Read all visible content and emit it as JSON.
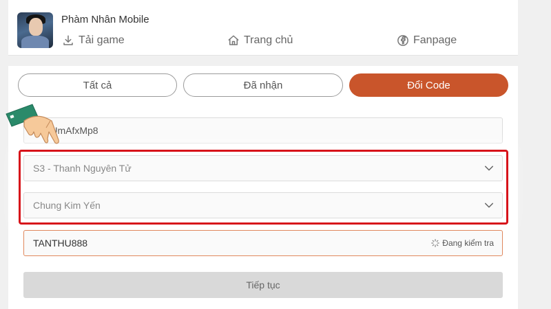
{
  "header": {
    "game_title": "Phàm Nhân Mobile",
    "nav": [
      {
        "label": "Tải game",
        "icon": "download-icon"
      },
      {
        "label": "Trang chủ",
        "icon": "home-icon"
      },
      {
        "label": "Fanpage",
        "icon": "facebook-icon"
      }
    ]
  },
  "tabs": [
    {
      "label": "Tất cả",
      "active": false
    },
    {
      "label": "Đã nhận",
      "active": false
    },
    {
      "label": "Đổi Code",
      "active": true
    }
  ],
  "form": {
    "account_value": "VUmAfxMp8",
    "server_value": "S3 - Thanh Nguyên Tử",
    "character_value": "Chung Kim Yến",
    "code_value": "TANTHU888",
    "code_status": "Đang kiểm tra",
    "continue_label": "Tiếp tục"
  },
  "colors": {
    "accent": "#c9552b",
    "highlight": "#d7131a",
    "page_bg": "#f0f0f0"
  }
}
